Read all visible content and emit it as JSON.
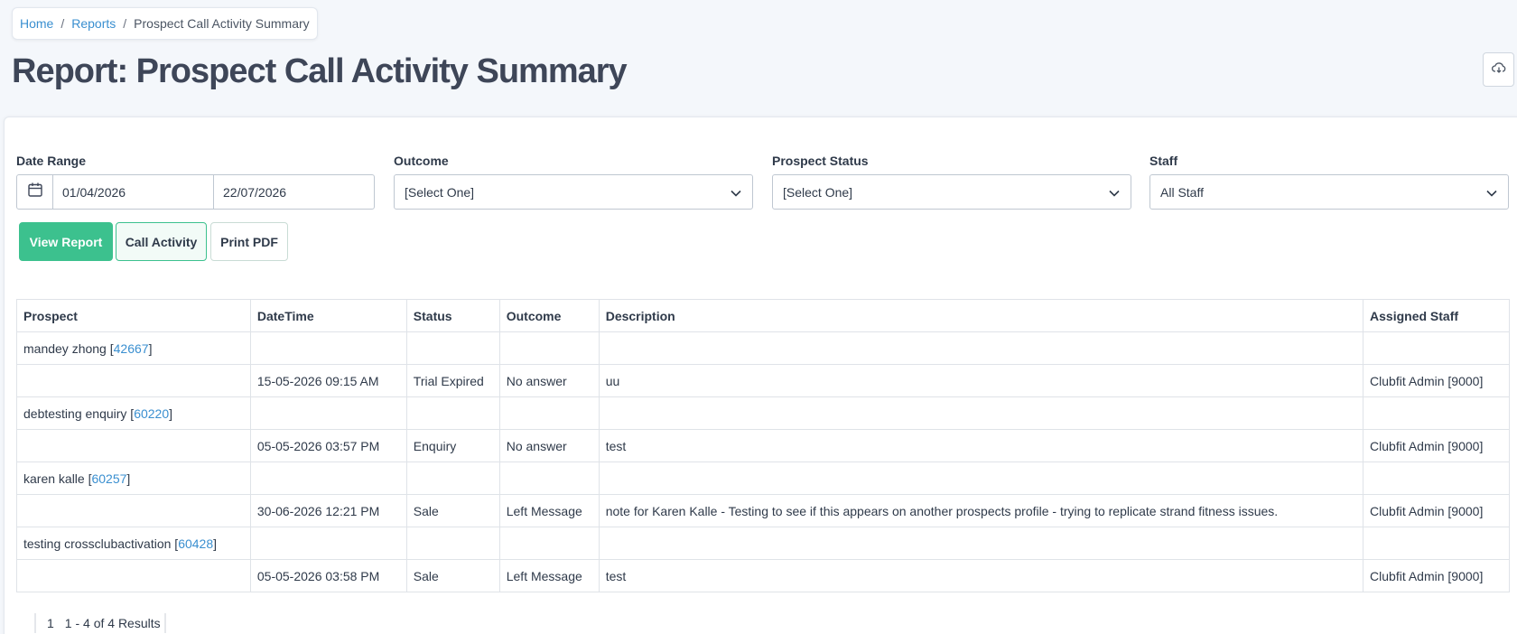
{
  "breadcrumb": {
    "home": "Home",
    "reports": "Reports",
    "separator": "/",
    "current": "Prospect Call Activity Summary"
  },
  "page": {
    "title": "Report: Prospect Call Activity Summary",
    "export_icon": "cloud-download-icon"
  },
  "filters": {
    "date_range": {
      "label": "Date Range",
      "from": "01/04/2026",
      "to": "22/07/2026",
      "icon": "calendar-icon"
    },
    "outcome": {
      "label": "Outcome",
      "value": "[Select One]"
    },
    "prospect_status": {
      "label": "Prospect Status",
      "value": "[Select One]"
    },
    "staff": {
      "label": "Staff",
      "value": "All Staff"
    }
  },
  "buttons": {
    "view_report": "View Report",
    "call_activity": "Call Activity",
    "print_pdf": "Print PDF"
  },
  "table": {
    "headers": [
      "Prospect",
      "DateTime",
      "Status",
      "Outcome",
      "Description",
      "Assigned Staff"
    ],
    "groups": [
      {
        "prospect_name": "mandey zhong",
        "prospect_id": "42667",
        "activity": {
          "datetime": "15-05-2026 09:15 AM",
          "status": "Trial Expired",
          "outcome": "No answer",
          "description": "uu",
          "staff": "Clubfit Admin [9000]"
        }
      },
      {
        "prospect_name": "debtesting enquiry",
        "prospect_id": "60220",
        "activity": {
          "datetime": "05-05-2026 03:57 PM",
          "status": "Enquiry",
          "outcome": "No answer",
          "description": "test",
          "staff": "Clubfit Admin [9000]"
        }
      },
      {
        "prospect_name": "karen kalle",
        "prospect_id": "60257",
        "activity": {
          "datetime": "30-06-2026 12:21 PM",
          "status": "Sale",
          "outcome": "Left Message",
          "description": "note for Karen Kalle - Testing to see if this appears on another prospects profile - trying to replicate strand fitness issues.",
          "staff": "Clubfit Admin [9000]"
        }
      },
      {
        "prospect_name": "testing crossclubactivation",
        "prospect_id": "60428",
        "activity": {
          "datetime": "05-05-2026 03:58 PM",
          "status": "Sale",
          "outcome": "Left Message",
          "description": "test",
          "staff": "Clubfit Admin [9000]"
        }
      }
    ]
  },
  "pagination": {
    "current_page": "1",
    "summary": "1 - 4 of 4 Results"
  },
  "colors": {
    "primary": "#3cc18e",
    "link": "#3a8fd0",
    "title": "#3e4658"
  }
}
